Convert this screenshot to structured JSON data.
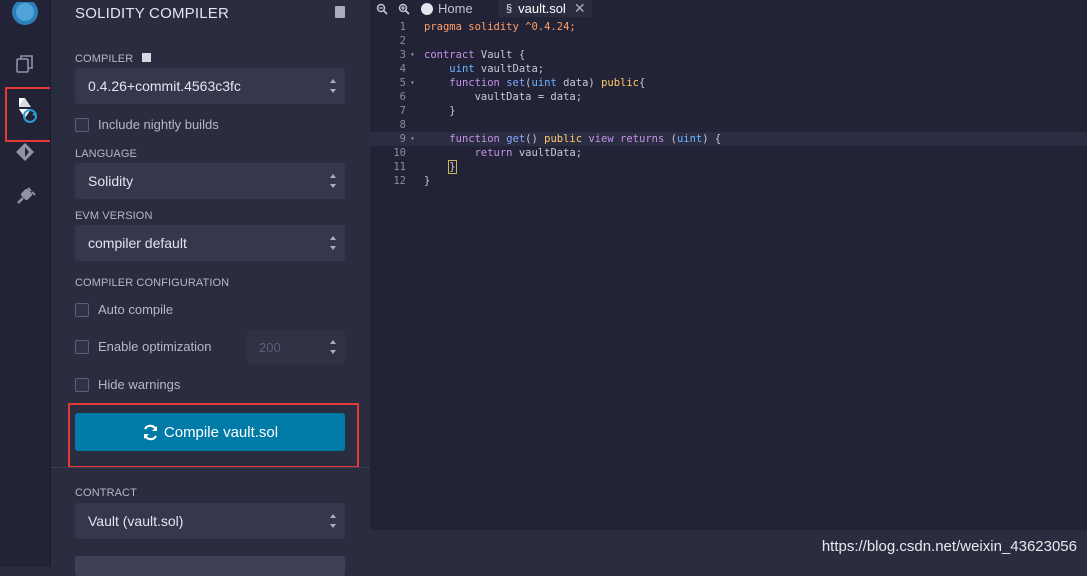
{
  "panel": {
    "title": "SOLIDITY COMPILER",
    "compiler_label": "COMPILER",
    "compiler_value": "0.4.26+commit.4563c3fc",
    "nightly_label": "Include nightly builds",
    "language_label": "LANGUAGE",
    "language_value": "Solidity",
    "evm_label": "EVM VERSION",
    "evm_value": "compiler default",
    "config_label": "COMPILER CONFIGURATION",
    "auto_compile": "Auto compile",
    "optimization": "Enable optimization",
    "runs": "200",
    "hide_warnings": "Hide warnings",
    "compile_button": "Compile vault.sol",
    "contract_label": "CONTRACT",
    "contract_value": "Vault (vault.sol)"
  },
  "tabs": {
    "home": "Home",
    "file": "vault.sol"
  },
  "code": {
    "line_numbers": [
      "1",
      "2",
      "3",
      "4",
      "5",
      "6",
      "7",
      "8",
      "9",
      "10",
      "11",
      "12"
    ]
  },
  "watermark": "https://blog.csdn.net/weixin_43623056",
  "colors": {
    "accent": "#007aa6",
    "highlight": "#e53935"
  }
}
